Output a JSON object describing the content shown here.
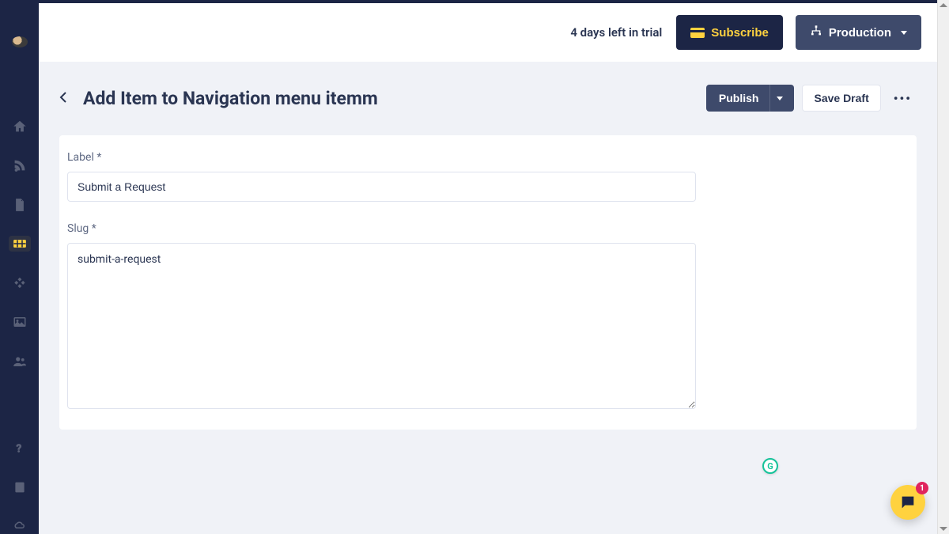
{
  "header": {
    "trial_text": "4 days left in trial",
    "subscribe_label": "Subscribe",
    "environment_label": "Production"
  },
  "page": {
    "title": "Add Item to Navigation menu itemm",
    "publish_label": "Publish",
    "save_draft_label": "Save Draft"
  },
  "form": {
    "label_field_label": "Label",
    "label_value": "Submit a Request",
    "slug_field_label": "Slug",
    "slug_value": "submit-a-request",
    "required_marker": "*"
  },
  "sidebar": {
    "items": [
      {
        "name": "home"
      },
      {
        "name": "blog"
      },
      {
        "name": "pages"
      },
      {
        "name": "collections",
        "active": true
      },
      {
        "name": "components"
      },
      {
        "name": "media"
      },
      {
        "name": "users"
      }
    ],
    "footer": [
      {
        "name": "help"
      },
      {
        "name": "docs"
      },
      {
        "name": "settings"
      }
    ]
  },
  "chat": {
    "badge_count": "1"
  }
}
